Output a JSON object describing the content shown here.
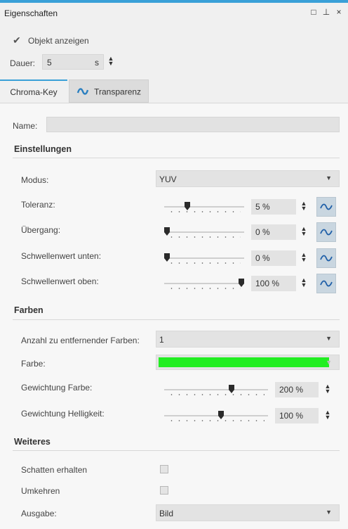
{
  "window": {
    "title": "Eigenschaften",
    "buttons": [
      "□",
      "⊥",
      "×"
    ]
  },
  "object_show": {
    "label": "Objekt anzeigen",
    "checked": true
  },
  "duration": {
    "label": "Dauer:",
    "value": "5",
    "unit": "s"
  },
  "tabs": [
    {
      "label": "Chroma-Key",
      "active": true
    },
    {
      "label": "Transparenz",
      "active": false,
      "icon": "transparency-icon"
    }
  ],
  "name_field": {
    "label": "Name:",
    "value": ""
  },
  "sections": {
    "einstellungen": "Einstellungen",
    "farben": "Farben",
    "weiteres": "Weiteres"
  },
  "einstellungen": {
    "modus": {
      "label": "Modus:",
      "value": "YUV"
    },
    "sliders": [
      {
        "label": "Toleranz:",
        "value": "5 %",
        "level": 0.27
      },
      {
        "label": "Übergang:",
        "value": "0 %",
        "level": 0.0
      },
      {
        "label": "Schwellenwert unten:",
        "value": "0 %",
        "level": 0.0
      },
      {
        "label": "Schwellenwert oben:",
        "value": "100 %",
        "level": 1.0
      }
    ]
  },
  "farben": {
    "anzahl": {
      "label": "Anzahl zu entfernender Farben:",
      "value": "1"
    },
    "farbe": {
      "label": "Farbe:",
      "color": "#22ee22"
    },
    "gewichtung_farbe": {
      "label": "Gewichtung Farbe:",
      "value": "200 %",
      "level": 0.66
    },
    "gewichtung_helligkeit": {
      "label": "Gewichtung Helligkeit:",
      "value": "100 %",
      "level": 0.55
    }
  },
  "weiteres": {
    "schatten": {
      "label": "Schatten erhalten",
      "checked": false
    },
    "umkehren": {
      "label": "Umkehren",
      "checked": false
    },
    "ausgabe": {
      "label": "Ausgabe:",
      "value": "Bild"
    }
  },
  "colors": {
    "accent": "#3aa0d8",
    "curve_button": "#c9d6e0"
  }
}
